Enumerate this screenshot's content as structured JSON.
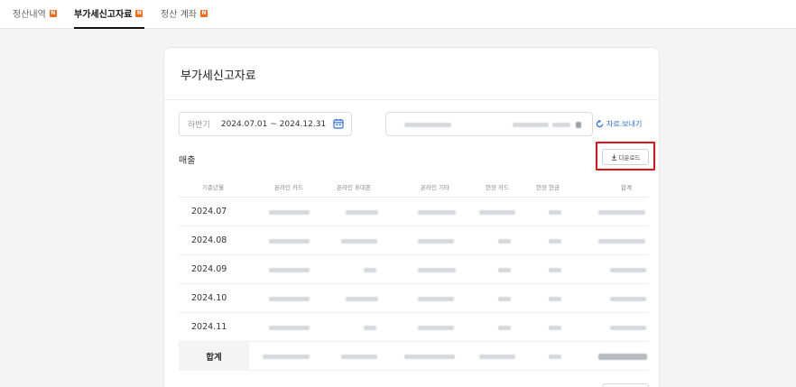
{
  "tabs": [
    {
      "label": "정산내역",
      "badge": "N"
    },
    {
      "label": "부가세신고자료",
      "badge": "N"
    },
    {
      "label": "정산 계좌",
      "badge": "N"
    }
  ],
  "card": {
    "title": "부가세신고자료",
    "period_label": "하반기",
    "date_range": "2024.07.01 ~ 2024.12.31",
    "send_label": "자료 보내기",
    "sales_label": "매출",
    "download_label": "다운로드"
  },
  "table": {
    "headers": [
      "기준년월",
      "온라인 카드",
      "온라인 휴대폰",
      "온라인 기타",
      "현장 카드",
      "현장 현금",
      "합계"
    ],
    "rows": [
      "2024.07",
      "2024.08",
      "2024.09",
      "2024.10",
      "2024.11"
    ],
    "total_label": "합계"
  },
  "icons": {
    "calendar": "calendar-icon",
    "refresh": "refresh-icon",
    "download": "download-icon"
  },
  "colors": {
    "accent": "#2f6fdb",
    "badge": "#f26b1d",
    "highlight": "#e0131a"
  }
}
